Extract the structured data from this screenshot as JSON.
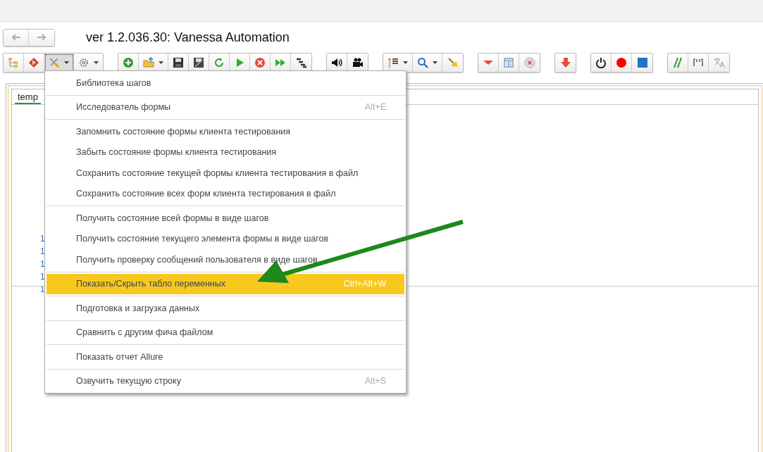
{
  "window": {
    "title": "ver 1.2.036.30: Vanessa Automation"
  },
  "nav_buttons": [
    {
      "kind": "back",
      "disabled": true
    },
    {
      "kind": "forward",
      "disabled": true
    }
  ],
  "toolbar": [
    [
      {
        "kind": "tree",
        "dropdown": false,
        "pressed": false
      },
      {
        "kind": "git",
        "dropdown": false,
        "pressed": false
      },
      {
        "kind": "tools",
        "dropdown": true,
        "pressed": true
      },
      {
        "kind": "gear",
        "dropdown": true,
        "pressed": false
      }
    ],
    [
      {
        "kind": "add",
        "dropdown": false,
        "pressed": false
      },
      {
        "kind": "folder",
        "dropdown": true,
        "pressed": false
      },
      {
        "kind": "save",
        "dropdown": false,
        "pressed": false
      },
      {
        "kind": "saveas",
        "dropdown": false,
        "pressed": false
      },
      {
        "kind": "refresh",
        "dropdown": false,
        "pressed": false
      },
      {
        "kind": "play",
        "dropdown": false,
        "pressed": false
      },
      {
        "kind": "stop",
        "dropdown": false,
        "pressed": false
      },
      {
        "kind": "fastforward",
        "dropdown": false,
        "pressed": false
      },
      {
        "kind": "steps",
        "dropdown": false,
        "pressed": false
      }
    ],
    [
      {
        "kind": "sound",
        "dropdown": false,
        "pressed": false
      },
      {
        "kind": "camera",
        "dropdown": false,
        "pressed": false
      }
    ],
    [
      {
        "kind": "list",
        "dropdown": true,
        "pressed": false
      },
      {
        "kind": "search",
        "dropdown": true,
        "pressed": false
      },
      {
        "kind": "broom",
        "dropdown": false,
        "pressed": false
      }
    ],
    [
      {
        "kind": "collapse",
        "dropdown": false,
        "pressed": false
      },
      {
        "kind": "table",
        "dropdown": false,
        "pressed": false
      },
      {
        "kind": "clear",
        "dropdown": false,
        "pressed": false
      }
    ],
    [
      {
        "kind": "down",
        "dropdown": false,
        "pressed": false
      }
    ],
    [
      {
        "kind": "power",
        "dropdown": false,
        "pressed": false
      },
      {
        "kind": "record",
        "dropdown": false,
        "pressed": false
      },
      {
        "kind": "square",
        "dropdown": false,
        "pressed": false
      }
    ],
    [
      {
        "kind": "comment",
        "dropdown": false,
        "pressed": false
      },
      {
        "kind": "quotes",
        "dropdown": false,
        "pressed": false
      },
      {
        "kind": "translate",
        "dropdown": false,
        "pressed": false
      }
    ]
  ],
  "editor": {
    "tab": "temp",
    "line_numbers": [
      "1",
      "1",
      "1",
      "1",
      "1"
    ]
  },
  "menu": {
    "groups": [
      [
        {
          "label": "Библиотека шагов",
          "selected": false
        }
      ],
      [
        {
          "label": "Исследователь формы",
          "shortcut": "Alt+E",
          "selected": false
        }
      ],
      [
        {
          "label": "Запомнить состояние формы клиента тестирования",
          "selected": false
        },
        {
          "label": "Забыть состояние формы клиента тестирования",
          "selected": false
        },
        {
          "label": "Сохранить состояние текущей формы клиента тестирования в файл",
          "selected": false
        },
        {
          "label": "Сохранить состояние всех форм клиента тестирования в файл",
          "selected": false
        }
      ],
      [
        {
          "label": "Получить состояние всей формы в виде шагов",
          "selected": false
        },
        {
          "label": "Получить состояние текущего элемента формы в виде шагов",
          "selected": false
        },
        {
          "label": "Получить проверку сообщений пользователя в виде шагов",
          "selected": false
        }
      ],
      [
        {
          "label": "Показать/Скрыть табло переменных",
          "shortcut": "Ctrl+Alt+W",
          "selected": true
        }
      ],
      [
        {
          "label": "Подготовка и загрузка данных",
          "selected": false
        }
      ],
      [
        {
          "label": "Сравнить с другим фича файлом",
          "selected": false
        }
      ],
      [
        {
          "label": "Показать отчет Allure",
          "selected": false
        }
      ],
      [
        {
          "label": "Озвучить текущую строку",
          "shortcut": "Alt+S",
          "selected": false
        }
      ]
    ]
  }
}
